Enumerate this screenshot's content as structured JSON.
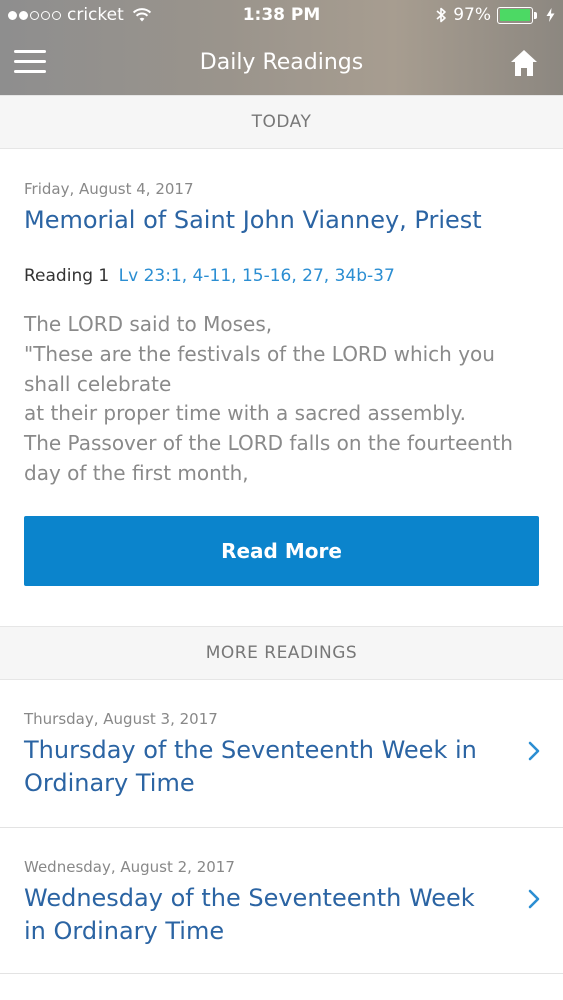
{
  "status_bar": {
    "carrier": "cricket",
    "time": "1:38 PM",
    "battery_percent": "97%",
    "battery_level": 0.97,
    "signal_bars_filled": 2,
    "signal_bars_total": 5
  },
  "navbar": {
    "title": "Daily Readings",
    "menu_icon": "hamburger-menu-icon",
    "home_icon": "home-icon"
  },
  "today_section": {
    "header": "TODAY",
    "date": "Friday, August 4, 2017",
    "title": "Memorial of Saint John Vianney, Priest",
    "reading_label": "Reading 1",
    "reading_ref": "Lv 23:1, 4-11, 15-16, 27, 34b-37",
    "excerpt": "The LORD said to Moses,\n\"These are the festivals of the LORD which you shall celebrate\nat their proper time with a sacred assembly.\nThe Passover of the LORD falls on the fourteenth day of the first month,",
    "read_more_label": "Read More"
  },
  "more_section": {
    "header": "MORE READINGS",
    "items": [
      {
        "date": "Thursday, August 3, 2017",
        "title": "Thursday of the Seventeenth Week in Ordinary Time"
      },
      {
        "date": "Wednesday, August 2, 2017",
        "title": "Wednesday of the Seventeenth Week in Ordinary Time"
      }
    ]
  },
  "colors": {
    "accent_blue": "#0b84cc",
    "link_blue": "#2b64a3",
    "reference_blue": "#2b8ed2",
    "battery_green": "#4cd964"
  }
}
